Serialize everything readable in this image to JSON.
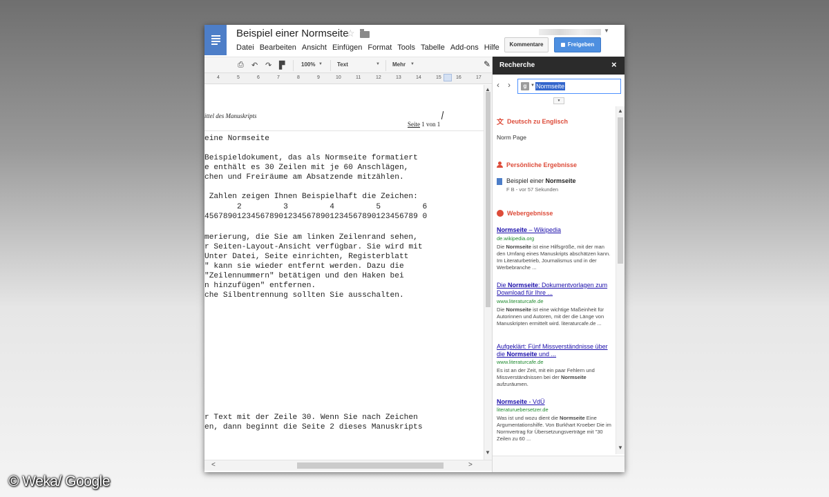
{
  "credit": "© Weka/ Google",
  "document": {
    "title": "Beispiel einer Normseite",
    "menu": [
      "Datei",
      "Bearbeiten",
      "Ansicht",
      "Einfügen",
      "Format",
      "Tools",
      "Tabelle",
      "Add-ons",
      "Hilfe"
    ],
    "buttons": {
      "comments": "Kommentare",
      "share": "Freigeben"
    }
  },
  "toolbar": {
    "zoom": "100%",
    "style": "Text",
    "more": "Mehr"
  },
  "ruler": [
    "4",
    "5",
    "6",
    "7",
    "8",
    "9",
    "10",
    "11",
    "12",
    "13",
    "14",
    "15",
    "16",
    "17"
  ],
  "page": {
    "running_header": "ittel des Manuskripts",
    "page_number": {
      "word": "Seite",
      "rest": " 1 von 1"
    },
    "lines": [
      "eine Normseite",
      "",
      "Beispieldokument, das als Normseite formatiert",
      "e enthält es 30 Zeilen mit je 60 Anschlägen,",
      "chen und Freiräume am Absatzende mitzählen.",
      "",
      " Zahlen zeigen Ihnen Beispielhaft die Zeichen:",
      "       2         3         4         5         6",
      "4567890123456789012345678901234567890123456789 0",
      "",
      "merierung, die Sie am linken Zeilenrand sehen,",
      "r Seiten-Layout-Ansicht verfügbar. Sie wird mit",
      "Unter Datei, Seite einrichten, Registerblatt",
      "\" kann sie wieder entfernt werden. Dazu die",
      "\"Zeilennummern\" betätigen und den Haken bei",
      "n hinzufügen\" entfernen.",
      "che Silbentrennung sollten Sie ausschalten."
    ],
    "bottom_lines": [
      "r Text mit der Zeile 30. Wenn Sie nach Zeichen",
      "en, dann beginnt die Seite 2 dieses Manuskripts"
    ]
  },
  "research": {
    "title": "Recherche",
    "close": "×",
    "search_value": "Normseite",
    "translation": {
      "heading": "Deutsch zu Englisch",
      "result": "Norm Page"
    },
    "personal": {
      "heading": "Persönliche Ergebnisse",
      "title_plain": "Beispiel einer ",
      "title_bold": "Normseite",
      "meta": "F B - vor 57 Sekunden"
    },
    "web": {
      "heading": "Webergebnisse",
      "results": [
        {
          "title_parts": [
            {
              "b": "Normseite"
            },
            {
              "t": " – Wikipedia"
            }
          ],
          "url": "de.wikipedia.org",
          "snippet_parts": [
            {
              "t": "Die "
            },
            {
              "b": "Normseite"
            },
            {
              "t": " ist eine Hilfsgröße, mit der man den Umfang eines Manuskripts abschätzen kann. Im Literaturbetrieb, Journalismus und in der Werbebranche ..."
            }
          ]
        },
        {
          "title_parts": [
            {
              "t": "Die "
            },
            {
              "b": "Normseite"
            },
            {
              "t": ": Dokumentvorlagen zum Download für Ihre ..."
            }
          ],
          "url": "www.literaturcafe.de",
          "snippet_parts": [
            {
              "t": "Die "
            },
            {
              "b": "Normseite"
            },
            {
              "t": " ist eine wichtige Maßeinheit für Autorinnen und Autoren, mit der die Länge von Manuskripten ermittelt wird. literaturcafe.de ..."
            }
          ]
        },
        {
          "title_parts": [
            {
              "t": "Aufgeklärt: Fünf Missverständnisse über die "
            },
            {
              "b": "Normseite"
            },
            {
              "t": " und ..."
            }
          ],
          "url": "www.literaturcafe.de",
          "snippet_parts": [
            {
              "t": "Es ist an der Zeit, mit ein paar Fehlern und Missverständnissen bei der "
            },
            {
              "b": "Normseite"
            },
            {
              "t": " aufzuräumen."
            }
          ]
        },
        {
          "title_parts": [
            {
              "b": "Normseite"
            },
            {
              "t": " - VdÜ"
            }
          ],
          "url": "literaturuebersetzer.de",
          "snippet_parts": [
            {
              "t": "Was ist und wozu dient die "
            },
            {
              "b": "Normseite"
            },
            {
              "t": " Eine Argumentationshilfe. Von Burkhart Kroeber Die im Normvertrag für Übersetzungsverträge mit \"30 Zeilen zu 60 ..."
            }
          ]
        }
      ]
    }
  },
  "colors": {
    "docs_blue": "#4d7ec8",
    "share_blue": "#4d8fe0",
    "section_red": "#dd4b39",
    "link_blue": "#1a0dab",
    "url_green": "#1e8a2e",
    "panel_header": "#2b2b2b"
  },
  "icons": [
    "docs-logo-icon",
    "star-icon",
    "folder-icon",
    "print-icon",
    "undo-icon",
    "redo-icon",
    "paint-format-icon",
    "pencil-icon",
    "close-icon",
    "back-icon",
    "forward-icon",
    "google-icon",
    "translate-icon",
    "person-icon",
    "globe-icon",
    "lock-icon"
  ]
}
